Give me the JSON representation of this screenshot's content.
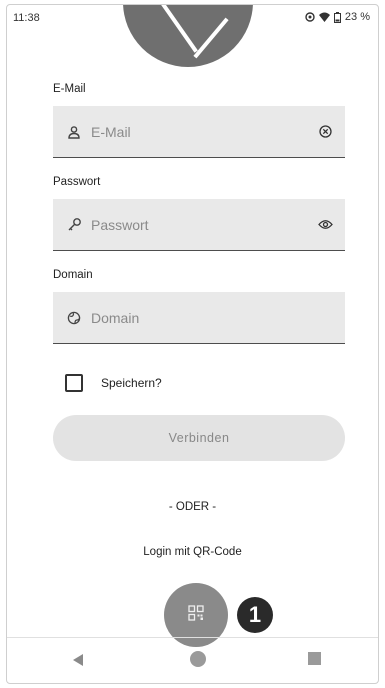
{
  "status_bar": {
    "time": "11:38",
    "battery": "23 %",
    "icons": [
      "data-saver-icon",
      "wifi-icon",
      "battery-icon"
    ]
  },
  "form": {
    "email": {
      "label": "E-Mail",
      "placeholder": "E-Mail",
      "value": "",
      "leading_icon": "person-icon",
      "trailing_icon": "clear-icon"
    },
    "password": {
      "label": "Passwort",
      "placeholder": "Passwort",
      "value": "",
      "leading_icon": "key-icon",
      "trailing_icon": "eye-icon"
    },
    "domain": {
      "label": "Domain",
      "placeholder": "Domain",
      "value": "",
      "leading_icon": "globe-icon"
    },
    "remember": {
      "label": "Speichern?",
      "checked": false
    },
    "connect_button": "Verbinden"
  },
  "separator": "- ODER -",
  "qr_login": {
    "label": "Login mit QR-Code",
    "button_icon": "qr-code-icon"
  },
  "callout_number": "1",
  "colors": {
    "field_bg": "#e9e9e9",
    "button_bg": "#e3e3e3",
    "fab_bg": "#8a8a8a",
    "logo": "#6f6f6f"
  }
}
